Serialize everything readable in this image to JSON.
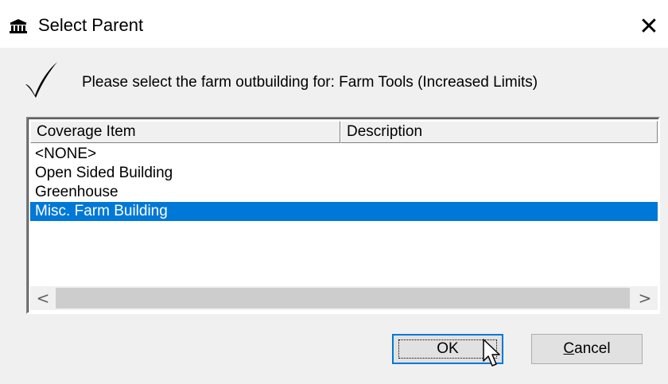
{
  "window": {
    "title": "Select Parent",
    "icon": "building-icon",
    "close_symbol": "✕"
  },
  "prompt": {
    "icon": "checkmark-icon",
    "text": "Please select the farm outbuilding for: Farm Tools (Increased Limits)"
  },
  "list": {
    "columns": [
      "Coverage Item",
      "Description"
    ],
    "rows": [
      {
        "item": "<NONE>",
        "description": ""
      },
      {
        "item": "Open Sided Building",
        "description": ""
      },
      {
        "item": "Greenhouse",
        "description": ""
      },
      {
        "item": "Misc. Farm Building",
        "description": "",
        "selected": true
      }
    ],
    "scroll_left": "<",
    "scroll_right": ">"
  },
  "buttons": {
    "ok_label": "OK",
    "cancel_label": "Cancel",
    "cancel_mnemonic": "C",
    "cancel_rest": "ancel"
  },
  "colors": {
    "selection": "#0078d7",
    "dialog_bg": "#f0f0f0"
  }
}
